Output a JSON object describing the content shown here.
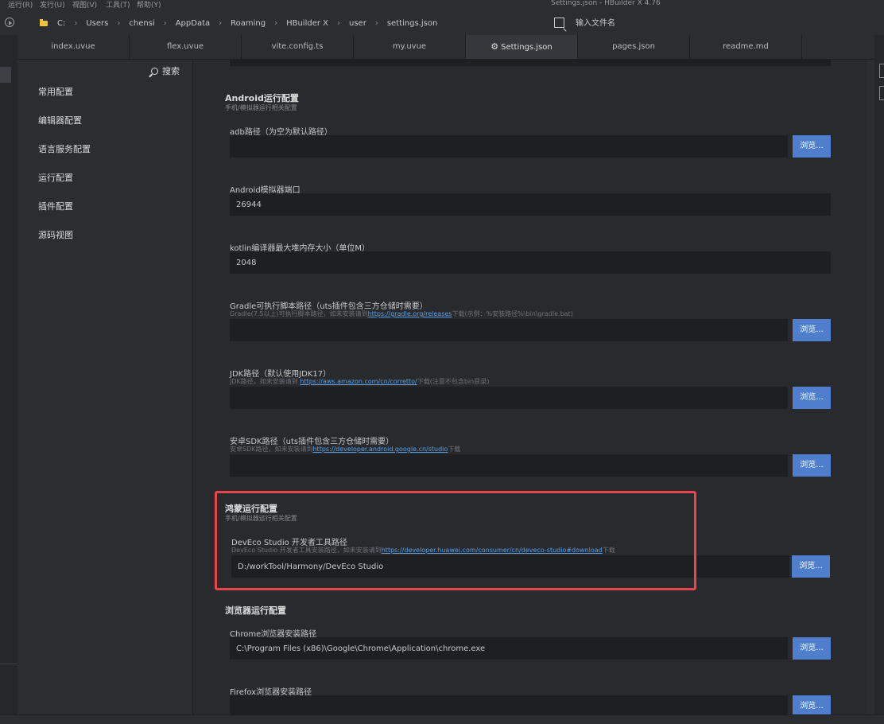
{
  "menubar": {
    "items": [
      "运行(R)",
      "发行(U)",
      "视图(V)",
      "工具(T)",
      "帮助(Y)"
    ],
    "window_title": "Settings.json - HBuilder X 4.76"
  },
  "addressbar": {
    "crumbs": [
      "C:",
      "Users",
      "chensi",
      "AppData",
      "Roaming",
      "HBuilder X",
      "user",
      "settings.json"
    ],
    "file_search_placeholder": "输入文件名"
  },
  "tabs": [
    {
      "label": "index.uvue"
    },
    {
      "label": "flex.uvue"
    },
    {
      "label": "vite.config.ts"
    },
    {
      "label": "my.uvue"
    },
    {
      "label": "Settings.json",
      "active": true
    },
    {
      "label": "pages.json"
    },
    {
      "label": "readme.md"
    }
  ],
  "sidebar": {
    "search_label": "搜索",
    "items": [
      "常用配置",
      "编辑器配置",
      "语言服务配置",
      "运行配置",
      "插件配置",
      "源码视图"
    ]
  },
  "content": {
    "android": {
      "title": "Android运行配置",
      "subtitle": "手机/模拟器运行相关配置",
      "adb": {
        "label": "adb路径（为空为默认路径）",
        "value": ""
      },
      "emulator_port": {
        "label": "Android模拟器端口",
        "value": "26944"
      },
      "kotlin_heap": {
        "label": "kotlin编译器最大堆内存大小（单位M）",
        "value": "2048"
      },
      "gradle": {
        "label": "Gradle可执行脚本路径（uts插件包含三方仓储时需要）",
        "desc_pre": "Gradle(7.5以上)可执行脚本路径，如未安装请到",
        "desc_link": "https://gradle.org/releases",
        "desc_post": "下载(示例：%安装路径%\\bin\\gradle.bat)",
        "value": ""
      },
      "jdk": {
        "label": "JDK路径（默认使用JDK17）",
        "desc_pre": "JDK路径，如未安装请到 ",
        "desc_link": "https://aws.amazon.com/cn/corretto/",
        "desc_post": "下载(注意不包含bin目录)",
        "value": ""
      },
      "sdk": {
        "label": "安卓SDK路径（uts插件包含三方仓储时需要）",
        "desc_pre": "安卓SDK路径，如未安装请到",
        "desc_link": "https://developer.android.google.cn/studio",
        "desc_post": "下载",
        "value": ""
      }
    },
    "harmony": {
      "title": "鸿蒙运行配置",
      "subtitle": "手机/模拟器运行相关配置",
      "deveco": {
        "label": "DevEco Studio 开发者工具路径",
        "desc_pre": "DevEco Studio 开发者工具安装路径，如未安装请到",
        "desc_link": "https://developer.huawei.com/consumer/cn/deveco-studio#download",
        "desc_post": "下载",
        "value": "D:/workTool/Harmony/DevEco Studio"
      }
    },
    "browser": {
      "title": "浏览器运行配置",
      "chrome": {
        "label": "Chrome浏览器安装路径",
        "value": "C:\\Program Files (x86)\\Google\\Chrome\\Application\\chrome.exe"
      },
      "firefox": {
        "label": "Firefox浏览器安装路径",
        "value": ""
      }
    },
    "browse_label": "浏览..."
  },
  "colors": {
    "highlight": "#e8464c",
    "button": "#4f7fcc",
    "link": "#5aa0e6"
  }
}
